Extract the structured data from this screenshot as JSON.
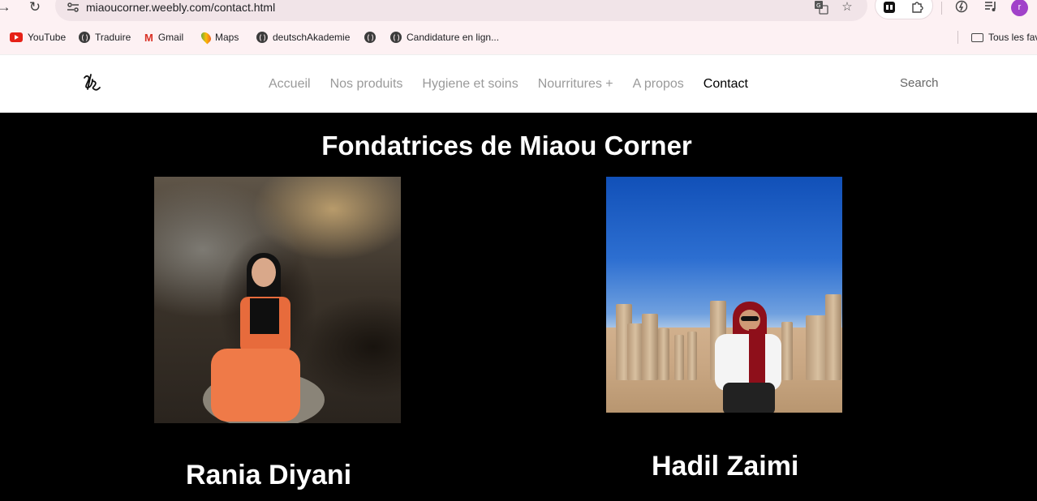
{
  "browser": {
    "url": "miaoucorner.weebly.com/contact.html",
    "profile_initial": "r",
    "bookmarks": [
      {
        "label": "YouTube",
        "icon": "youtube-icon"
      },
      {
        "label": "Traduire",
        "icon": "globe-icon"
      },
      {
        "label": "Gmail",
        "icon": "gmail-icon"
      },
      {
        "label": "Maps",
        "icon": "maps-icon"
      },
      {
        "label": "deutschAkademie",
        "icon": "globe-icon"
      },
      {
        "label": "",
        "icon": "globe-icon"
      },
      {
        "label": "Candidature en lign...",
        "icon": "globe-icon"
      }
    ],
    "all_bookmarks_label": "Tous les fav"
  },
  "site": {
    "nav": [
      "Accueil",
      "Nos produits",
      "Hygiene et soins",
      "Nourritures +",
      "A propos",
      "Contact"
    ],
    "active_nav": "Contact",
    "search_label": "Search"
  },
  "content": {
    "heading": "Fondatrices de Miaou Corner",
    "founders": [
      {
        "name": "Rania Diyani"
      },
      {
        "name": "Hadil Zaimi"
      }
    ]
  },
  "colors": {
    "page_background": "#000000",
    "browser_chrome": "#fdf1f3",
    "nav_inactive": "#9a9a9a",
    "nav_active": "#000000",
    "profile": "#a142c9"
  }
}
